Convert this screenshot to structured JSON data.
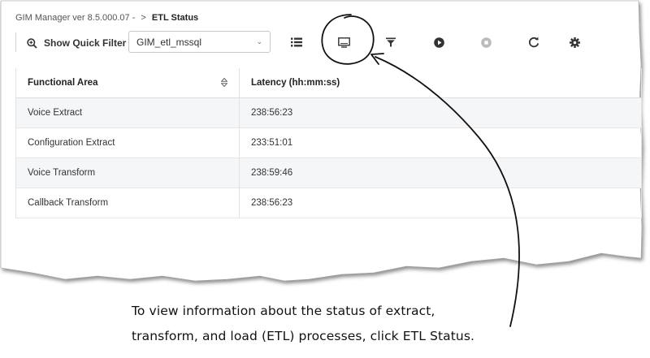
{
  "breadcrumb": {
    "parent": "GIM Manager ver 8.5.000.07 -",
    "separator": ">",
    "current": "ETL Status"
  },
  "toolbar": {
    "quick_filter_label": "Show Quick Filter",
    "quick_filter_icon": "zoom-in-icon",
    "tenant_select_value": "GIM_etl_mssql",
    "buttons": [
      {
        "name": "list-view",
        "icon": "list-icon"
      },
      {
        "name": "etl-status",
        "icon": "monitor-icon",
        "highlighted": true
      },
      {
        "name": "filter",
        "icon": "filter-icon"
      },
      {
        "name": "start",
        "icon": "play-icon"
      },
      {
        "name": "stop",
        "icon": "stop-icon",
        "disabled": true
      },
      {
        "name": "refresh",
        "icon": "refresh-icon"
      },
      {
        "name": "settings",
        "icon": "gear-icon"
      }
    ]
  },
  "table": {
    "columns": [
      "Functional Area",
      "Latency (hh:mm:ss)"
    ],
    "rows": [
      [
        "Voice Extract",
        "238:56:23"
      ],
      [
        "Configuration Extract",
        "233:51:01"
      ],
      [
        "Voice Transform",
        "238:59:46"
      ],
      [
        "Callback Transform",
        "238:56:23"
      ]
    ]
  },
  "caption": {
    "line1": "To view information about the status of extract,",
    "line2": "transform, and load (ETL) processes, click ETL Status."
  },
  "colors": {
    "icon": "#333333",
    "disabled_icon": "#bbbbbb",
    "row_alt": "#f4f6f8"
  }
}
